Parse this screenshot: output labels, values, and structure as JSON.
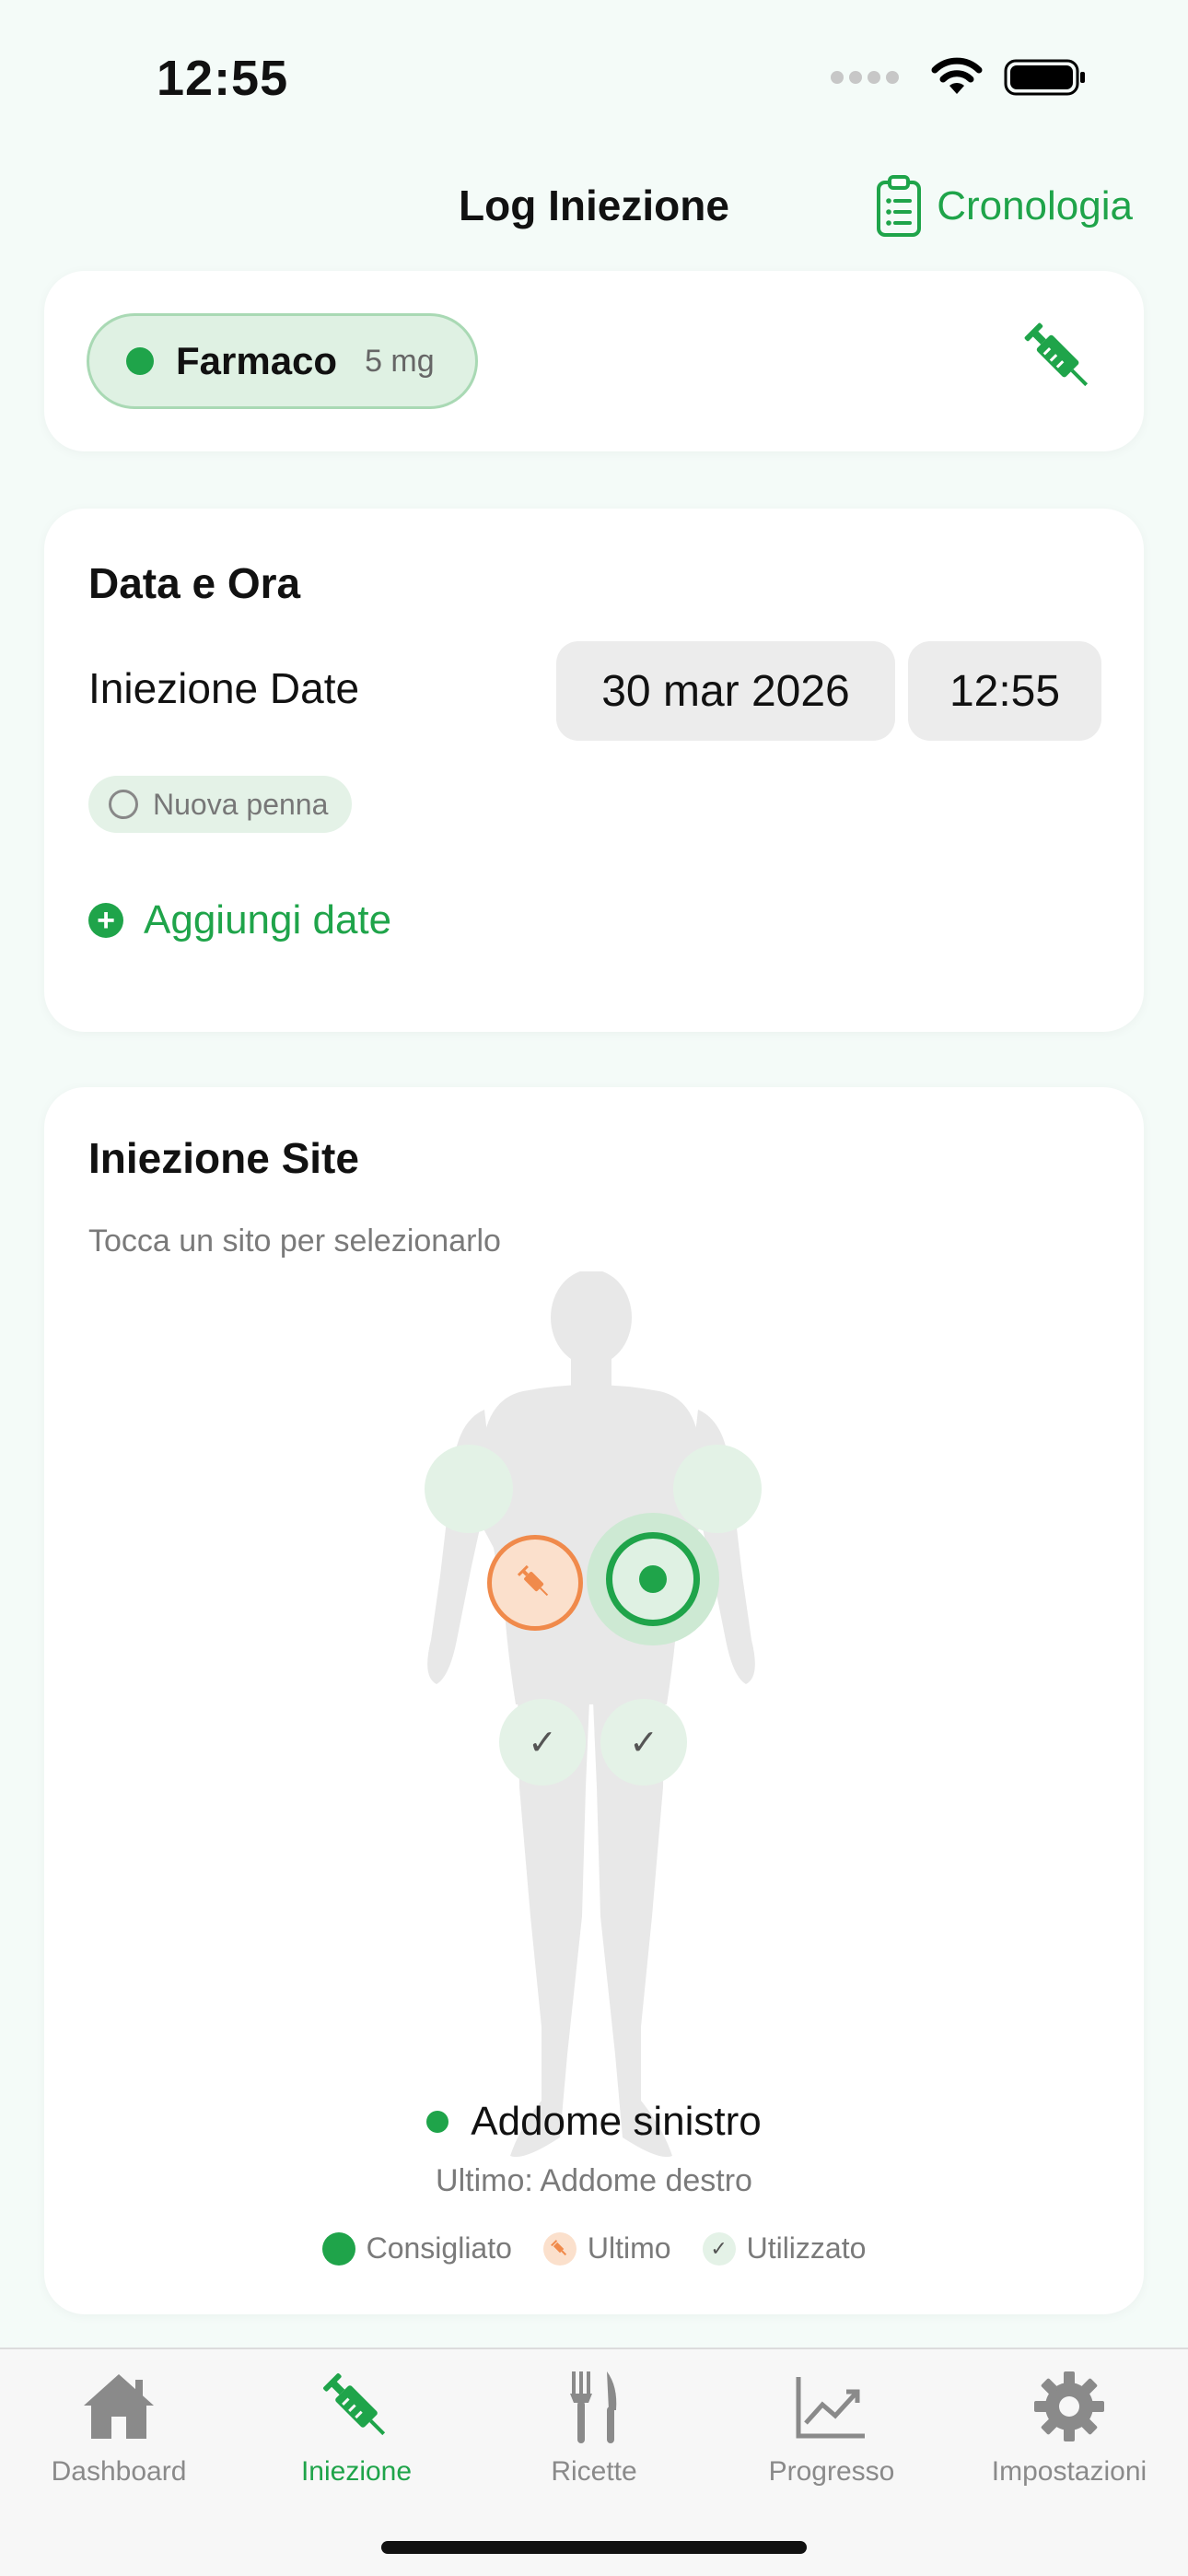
{
  "status_bar": {
    "time": "12:55"
  },
  "nav": {
    "title": "Log Iniezione",
    "history_label": "Cronologia"
  },
  "medication": {
    "name": "Farmaco",
    "dose": "5 mg"
  },
  "date_card": {
    "heading": "Data e Ora",
    "injection_date_label": "Iniezione Date",
    "date_value": "30 mar 2026",
    "time_value": "12:55",
    "new_pen_label": "Nuova penna",
    "add_dates_label": "Aggiungi date"
  },
  "site_card": {
    "heading": "Iniezione Site",
    "subtitle": "Tocca un sito per selezionarlo",
    "selected_site": "Addome sinistro",
    "last_site": "Ultimo: Addome destro",
    "legend": {
      "recommended": "Consigliato",
      "last": "Ultimo",
      "used": "Utilizzato"
    }
  },
  "tabs": [
    {
      "label": "Dashboard",
      "icon": "house-icon",
      "active": false
    },
    {
      "label": "Iniezione",
      "icon": "syringe-icon",
      "active": true
    },
    {
      "label": "Ricette",
      "icon": "fork-knife-icon",
      "active": false
    },
    {
      "label": "Progresso",
      "icon": "chart-icon",
      "active": false
    },
    {
      "label": "Impostazioni",
      "icon": "gear-icon",
      "active": false
    }
  ],
  "colors": {
    "accent": "#1fa44a",
    "last_site": "#f08a4b",
    "background": "#f4fbf8"
  }
}
